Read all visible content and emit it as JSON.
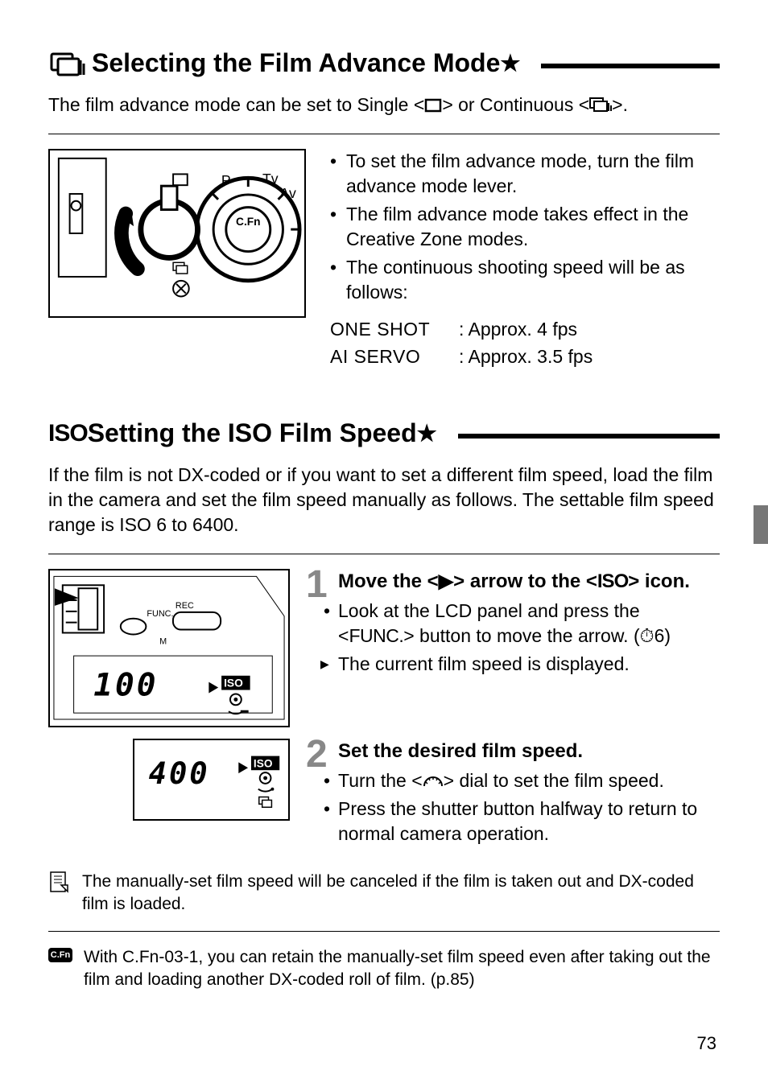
{
  "section1": {
    "heading": "Selecting the Film Advance Mode",
    "star": "★",
    "intro_pre": "The film advance mode can be set to Single <",
    "intro_mid": "> or Continuous <",
    "intro_post": ">.",
    "bullets": [
      "To set the film advance mode, turn the film advance mode lever.",
      "The film advance mode takes effect in the Creative Zone modes.",
      "The continuous shooting speed will be as follows:"
    ],
    "fps": [
      {
        "label": "ONE SHOT",
        "value": ": Approx. 4 fps"
      },
      {
        "label": "AI SERVO",
        "value": ": Approx. 3.5 fps"
      }
    ]
  },
  "section2": {
    "iso_label": "ISO",
    "heading": " Setting the ISO Film Speed",
    "star": "★",
    "intro": "If the film is not DX-coded or if you want to set a different film speed, load the film in the camera and set the film speed manually as follows. The settable film speed range is ISO 6 to 6400.",
    "step1": {
      "num": "1",
      "head_pre": "Move the <",
      "head_mid": "> arrow to the <",
      "head_iso": "ISO",
      "head_post": "> icon.",
      "b1_pre": "Look at the LCD panel and press the <",
      "b1_func": "FUNC.",
      "b1_post": "> button to move the arrow. (⏱6)",
      "b2": "The current film speed is displayed.",
      "lcd_value": "100",
      "lcd_iso": "ISO"
    },
    "step2": {
      "num": "2",
      "head": "Set the desired film speed.",
      "b1_pre": "Turn the <",
      "b1_post": "> dial to set the film speed.",
      "b2": "Press the shutter button halfway to return to normal camera operation.",
      "lcd_value": "400",
      "lcd_iso": "ISO"
    },
    "note1": "The manually-set film speed will be canceled if the film is taken out and DX-coded film is loaded.",
    "cfn_label": "C.Fn",
    "note2": "With C.Fn-03-1, you can retain the manually-set film speed even after taking out the film and loading another DX-coded roll of film. (p.85)"
  },
  "page_number": "73"
}
